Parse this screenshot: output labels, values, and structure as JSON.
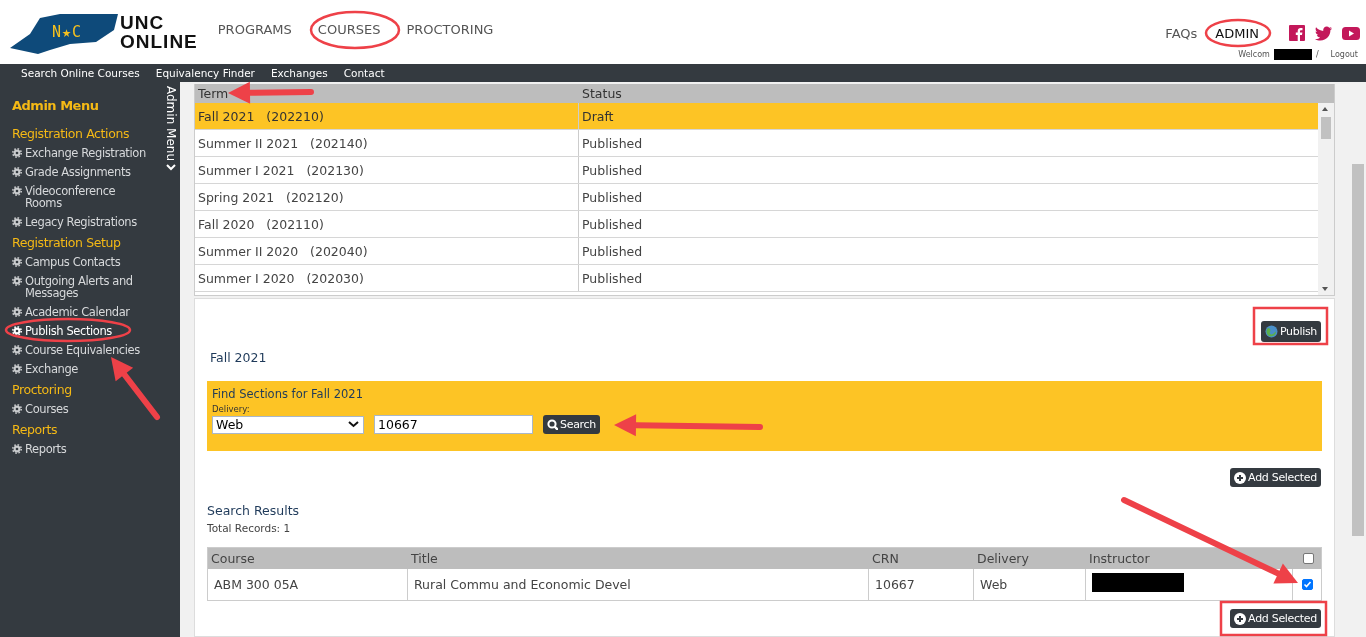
{
  "header": {
    "logo": {
      "badge": "N★C",
      "line1": "UNC",
      "line2": "ONLINE"
    },
    "nav": [
      {
        "label": "PROGRAMS"
      },
      {
        "label": "COURSES"
      },
      {
        "label": "PROCTORING"
      }
    ],
    "links": [
      {
        "label": "FAQs",
        "kind": "plain"
      },
      {
        "label": "ADMIN",
        "kind": "strong"
      }
    ],
    "user": {
      "welcome": "Welcom",
      "separator": "/",
      "logout": "Logout"
    }
  },
  "subnav": [
    "Search Online Courses",
    "Equivalency Finder",
    "Exchanges",
    "Contact"
  ],
  "sidebar": {
    "title": "Admin Menu",
    "tab_label": "Admin Menu",
    "sections": [
      {
        "heading": "Registration Actions",
        "items": [
          {
            "label": "Exchange Registration",
            "selected": false
          },
          {
            "label": "Grade Assignments",
            "selected": false
          },
          {
            "label": "Videoconference Rooms",
            "selected": false
          },
          {
            "label": "Legacy Registrations",
            "selected": false
          }
        ]
      },
      {
        "heading": "Registration Setup",
        "items": [
          {
            "label": "Campus Contacts",
            "selected": false
          },
          {
            "label": "Outgoing Alerts and Messages",
            "selected": false
          },
          {
            "label": "Academic Calendar",
            "selected": false
          },
          {
            "label": "Publish Sections",
            "selected": true
          },
          {
            "label": "Course Equivalencies",
            "selected": false
          },
          {
            "label": "Exchange",
            "selected": false
          }
        ]
      },
      {
        "heading": "Proctoring",
        "items": [
          {
            "label": "Courses",
            "selected": false
          }
        ]
      },
      {
        "heading": "Reports",
        "items": [
          {
            "label": "Reports",
            "selected": false
          }
        ]
      }
    ]
  },
  "terms": {
    "columns": [
      "Term",
      "Status"
    ],
    "rows": [
      {
        "term": "Fall 2021",
        "code": "(202210)",
        "status": "Draft",
        "selected": true
      },
      {
        "term": "Summer II 2021",
        "code": "(202140)",
        "status": "Published",
        "selected": false
      },
      {
        "term": "Summer I 2021",
        "code": "(202130)",
        "status": "Published",
        "selected": false
      },
      {
        "term": "Spring 2021",
        "code": "(202120)",
        "status": "Published",
        "selected": false
      },
      {
        "term": "Fall 2020",
        "code": "(202110)",
        "status": "Published",
        "selected": false
      },
      {
        "term": "Summer II 2020",
        "code": "(202040)",
        "status": "Published",
        "selected": false
      },
      {
        "term": "Summer I 2020",
        "code": "(202030)",
        "status": "Published",
        "selected": false
      }
    ]
  },
  "panel": {
    "publish_button": "Publish",
    "term_title": "Fall 2021",
    "find": {
      "title": "Find Sections for Fall 2021",
      "delivery_label": "Delivery:",
      "delivery_value": "Web",
      "crn_value": "10667",
      "search_button": "Search"
    },
    "add_selected_top": "Add Selected",
    "results": {
      "title": "Search Results",
      "total": "Total Records: 1",
      "columns": [
        "Course",
        "Title",
        "CRN",
        "Delivery",
        "Instructor"
      ],
      "header_checked": false,
      "rows": [
        {
          "course": "ABM 300 05A",
          "title": "Rural Commu and Economic Devel",
          "crn": "10667",
          "delivery": "Web",
          "checked": true
        }
      ]
    },
    "add_selected_bottom": "Add Selected"
  }
}
